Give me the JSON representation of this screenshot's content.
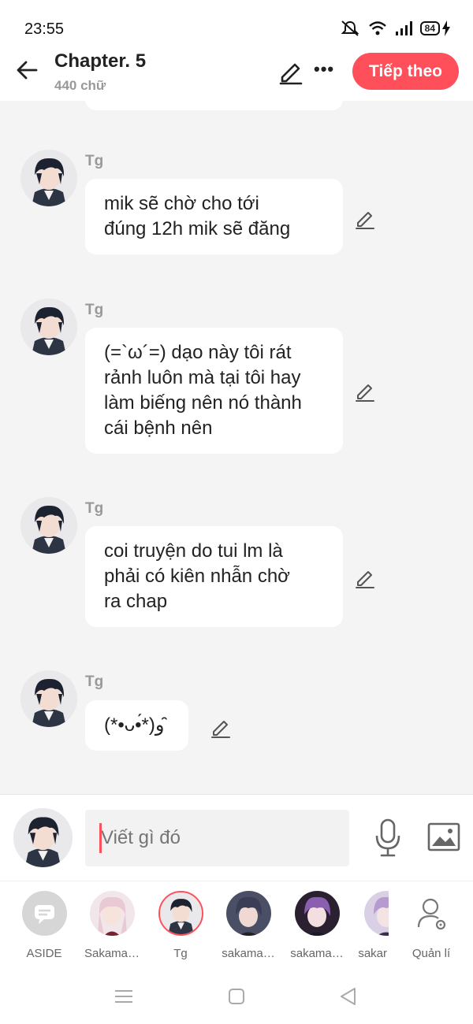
{
  "status_bar": {
    "time": "23:55",
    "battery": "84"
  },
  "header": {
    "title": "Chapter. 5",
    "subtitle": "440 chữ",
    "next_label": "Tiếp theo"
  },
  "messages": [
    {
      "sender": "Tg",
      "lines": [
        "mik sẽ chờ cho tới",
        "đúng 12h mik sẽ đăng"
      ]
    },
    {
      "sender": "Tg",
      "lines": [
        "(=`ω´=) dạo này tôi rát",
        "rảnh luôn mà tại tôi hay",
        "làm biếng nên nó thành",
        "cái bệnh nên"
      ]
    },
    {
      "sender": "Tg",
      "lines": [
        "coi truyện do tui lm là",
        "phải có kiên nhẫn chờ",
        "ra chap"
      ]
    },
    {
      "sender": "Tg",
      "lines": [
        "(*•ᴗ•́*)و ̑̑"
      ]
    }
  ],
  "compose": {
    "placeholder": "Viết gì đó"
  },
  "characters": [
    {
      "label": "ASIDE",
      "icon": "chat-bubble-icon"
    },
    {
      "label": "Sakama…"
    },
    {
      "label": "Tg"
    },
    {
      "label": "sakama…"
    },
    {
      "label": "sakama…"
    },
    {
      "label": "sakar"
    },
    {
      "label": "Quản lí",
      "icon": "manage-user-icon"
    }
  ],
  "colors": {
    "accent": "#ff4f5a",
    "background": "#f4f4f4",
    "bubble": "#ffffff",
    "muted_text": "#999999"
  },
  "icons": [
    "back-arrow-icon",
    "pencil-icon",
    "more-dots-icon",
    "microphone-icon",
    "image-icon",
    "menu-icon",
    "home-square-icon",
    "back-triangle-icon",
    "mute-bell-icon",
    "wifi-icon",
    "signal-icon",
    "battery-icon",
    "charging-icon"
  ]
}
